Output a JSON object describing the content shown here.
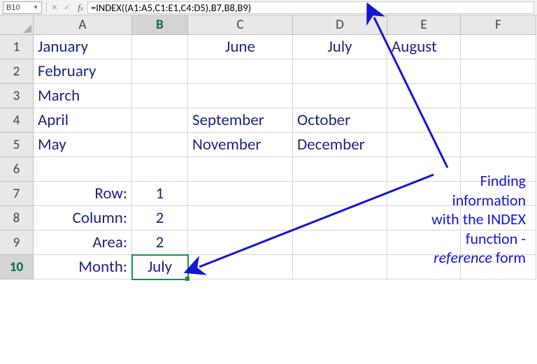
{
  "namebox": {
    "value": "B10"
  },
  "formula_bar": {
    "formula": "=INDEX((A1:A5,C1:E1,C4:D5),B7,B8,B9)"
  },
  "columns": [
    "A",
    "B",
    "C",
    "D",
    "E",
    "F"
  ],
  "rows": [
    "1",
    "2",
    "3",
    "4",
    "5",
    "6",
    "7",
    "8",
    "9",
    "10"
  ],
  "cells": {
    "A1": "January",
    "C1": "June",
    "D1": "July",
    "E1": "August",
    "A2": "February",
    "A3": "March",
    "A4": "April",
    "C4": "September",
    "D4": "October",
    "A5": "May",
    "C5": "November",
    "D5": "December",
    "A7": "Row:",
    "B7": "1",
    "A8": "Column:",
    "B8": "2",
    "A9": "Area:",
    "B9": "2",
    "A10": "Month:",
    "B10": "July"
  },
  "annotation": {
    "line1": "Finding",
    "line2": "information",
    "line3": "with the INDEX",
    "line4": "function -",
    "line5_italic": "reference",
    "line5_end": " form"
  },
  "active_cell": "B10",
  "colors": {
    "text": "#1F237F",
    "selection": "#1a8f4d",
    "arrow": "#1515d4"
  }
}
